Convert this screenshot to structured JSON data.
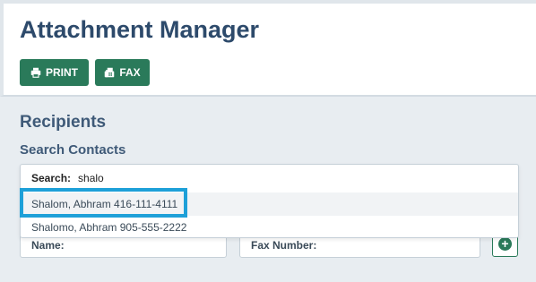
{
  "header": {
    "title": "Attachment Manager",
    "print_label": "PRINT",
    "fax_label": "FAX"
  },
  "recipients": {
    "section_title": "Recipients",
    "search_contacts_label": "Search Contacts",
    "name_label": "Name:",
    "fax_number_label": "Fax Number:"
  },
  "dropdown": {
    "search_label": "Search:",
    "search_value": "shalo",
    "results": [
      {
        "text": "Shalom, Abhram 416-111-4111"
      },
      {
        "text": "Shalomo, Abhram 905-555-2222"
      }
    ]
  },
  "colors": {
    "accent": "#2a7a5a",
    "heading": "#2d4a6b",
    "highlight": "#1ea0d8"
  }
}
